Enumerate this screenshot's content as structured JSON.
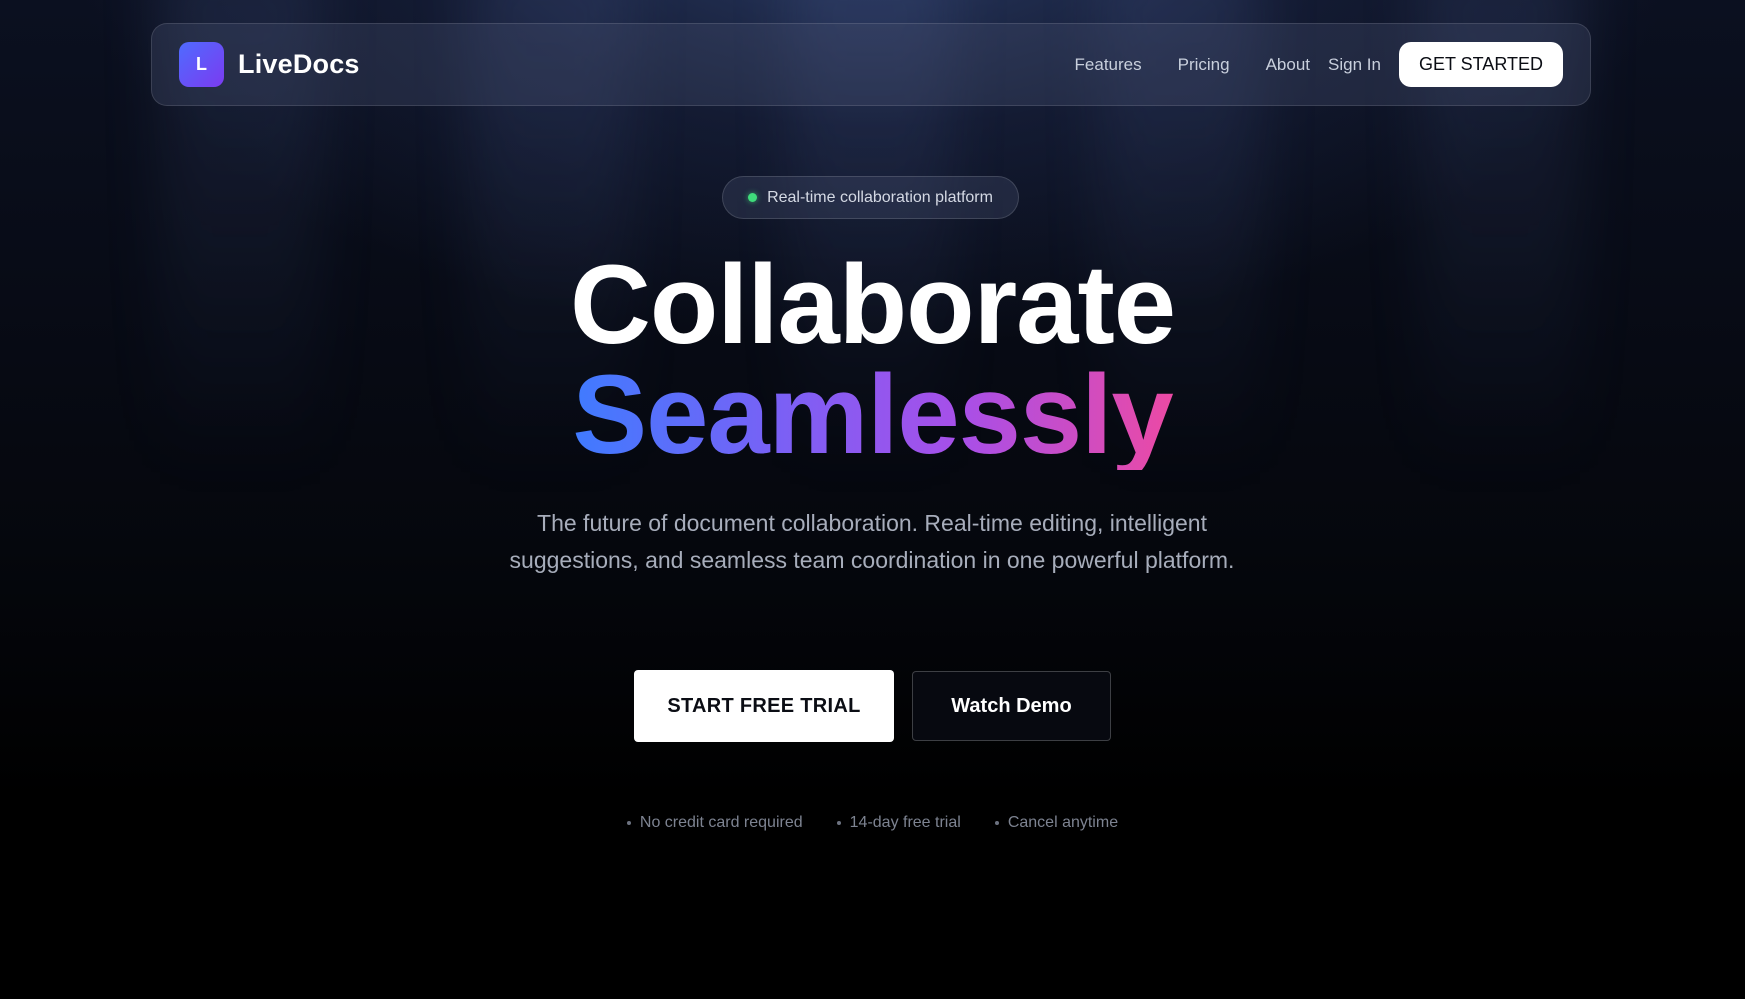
{
  "nav": {
    "logo_letter": "L",
    "brand": "LiveDocs",
    "links": [
      {
        "label": "Features"
      },
      {
        "label": "Pricing"
      },
      {
        "label": "About"
      }
    ],
    "sign_in": "Sign In",
    "cta": "GET STARTED"
  },
  "hero": {
    "badge": "Real-time collaboration platform",
    "title_line1": "Collaborate",
    "title_line2": "Seamlessly",
    "subtitle": "The future of document collaboration. Real-time editing, intelligent suggestions, and seamless team coordination in one powerful platform.",
    "primary_cta": "START FREE TRIAL",
    "secondary_cta": "Watch Demo",
    "perks": [
      "No credit card required",
      "14-day free trial",
      "Cancel anytime"
    ]
  },
  "colors": {
    "status_dot": "#3fdc7b",
    "gradient_start": "#3f7bff",
    "gradient_mid": "#a84fe8",
    "gradient_end": "#ec4aa4",
    "logo_gradient_start": "#4f6bff",
    "logo_gradient_end": "#7b3bf0"
  },
  "icons": {
    "status": "status-dot-icon",
    "perk_bullet": "bullet-icon"
  }
}
